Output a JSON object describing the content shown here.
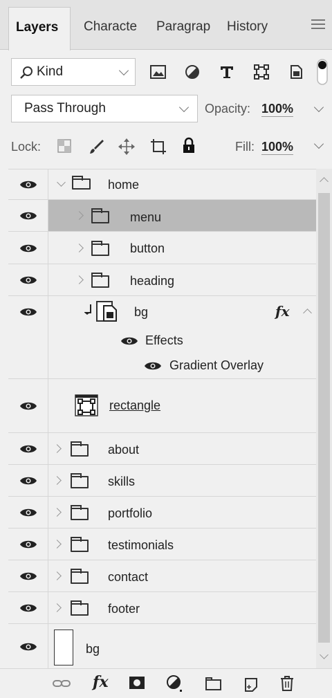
{
  "tabs": [
    {
      "label": "Layers"
    },
    {
      "label": "Characte"
    },
    {
      "label": "Paragrap"
    },
    {
      "label": "History"
    }
  ],
  "filter": {
    "kind_label": "Kind"
  },
  "blend": {
    "mode": "Pass Through",
    "opacity_label": "Opacity:",
    "opacity_value": "100%"
  },
  "lock": {
    "label": "Lock:",
    "fill_label": "Fill:",
    "fill_value": "100%"
  },
  "layers": [
    {
      "name": "home"
    },
    {
      "name": "menu"
    },
    {
      "name": "button"
    },
    {
      "name": "heading"
    },
    {
      "name": "bg",
      "fx": "fx",
      "effects_label": "Effects",
      "effect_name": "Gradient Overlay"
    },
    {
      "name": "rectangle"
    },
    {
      "name": "about"
    },
    {
      "name": "skills"
    },
    {
      "name": "portfolio"
    },
    {
      "name": "testimonials"
    },
    {
      "name": "contact"
    },
    {
      "name": "footer"
    },
    {
      "name": "bg"
    }
  ],
  "bottom": {
    "fx_label": "fx"
  }
}
